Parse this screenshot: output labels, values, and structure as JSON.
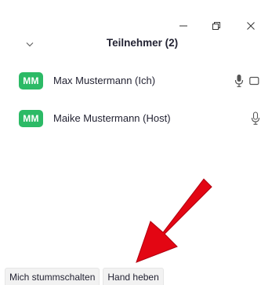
{
  "window_controls": {
    "minimize_icon": "minimize-icon",
    "restore_icon": "restore-icon",
    "close_icon": "close-icon"
  },
  "panel": {
    "title": "Teilnehmer (2)",
    "collapse_icon": "chevron-down-icon"
  },
  "participants": [
    {
      "initials": "MM",
      "name": "Max Mustermann (Ich)",
      "avatar_color": "#2cba66",
      "mic": "microphone-icon",
      "video": "video-icon"
    },
    {
      "initials": "MM",
      "name": "Maike Mustermann (Host)",
      "avatar_color": "#2cba66",
      "mic": "microphone-icon"
    }
  ],
  "toolbar": {
    "mute_label": "Mich stummschalten",
    "raise_hand_label": "Hand heben"
  },
  "colors": {
    "accent_avatar": "#2cba66",
    "annotation_arrow": "#e30613"
  }
}
